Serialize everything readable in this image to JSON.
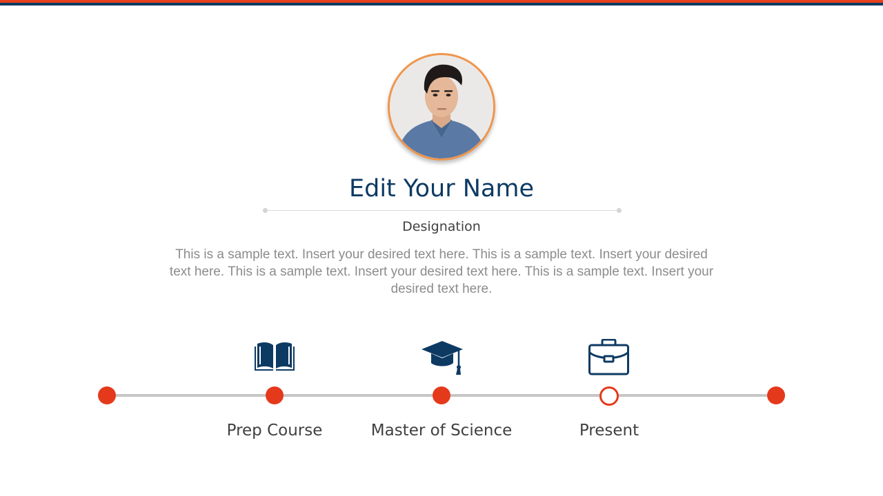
{
  "profile": {
    "name": "Edit Your Name",
    "designation": "Designation",
    "description": "This is a sample text. Insert your desired text here. This is a sample text. Insert your desired text here. This is a sample text. Insert your desired text here. This is a sample text. Insert your desired text here."
  },
  "timeline": {
    "milestones": [
      {
        "label": "Prep Course",
        "icon": "book-icon"
      },
      {
        "label": "Master of Science",
        "icon": "graduation-cap-icon"
      },
      {
        "label": "Present",
        "icon": "briefcase-icon"
      }
    ]
  },
  "colors": {
    "accent": "#e5391c",
    "navy": "#0d3a63",
    "avatar_border": "#f0954a",
    "line": "#c6c6c6"
  }
}
